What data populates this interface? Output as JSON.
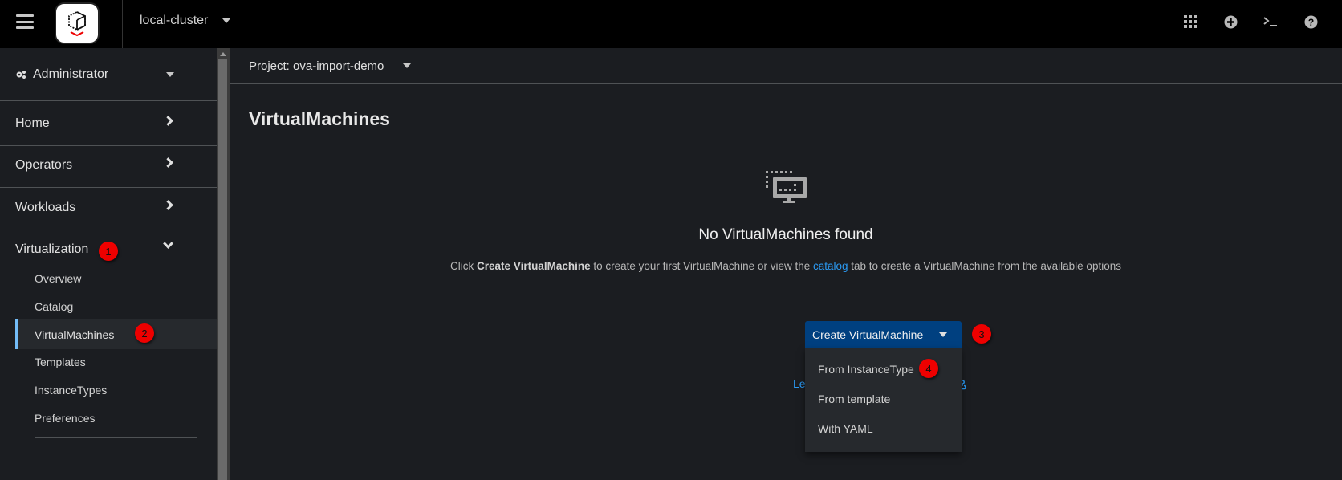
{
  "masthead": {
    "cluster": "local-cluster",
    "tools": [
      "app-launcher-icon",
      "quick-create-icon",
      "terminal-icon",
      "help-icon"
    ]
  },
  "sidebar": {
    "perspective": "Administrator",
    "sections": [
      {
        "label": "Home",
        "expanded": false
      },
      {
        "label": "Operators",
        "expanded": false
      },
      {
        "label": "Workloads",
        "expanded": false
      },
      {
        "label": "Virtualization",
        "expanded": true,
        "badge": "1"
      }
    ],
    "virtualization_items": [
      {
        "label": "Overview"
      },
      {
        "label": "Catalog"
      },
      {
        "label": "VirtualMachines",
        "active": true,
        "badge": "2"
      },
      {
        "label": "Templates"
      },
      {
        "label": "InstanceTypes"
      },
      {
        "label": "Preferences"
      }
    ]
  },
  "main": {
    "project": "Project: ova-import-demo",
    "title": "VirtualMachines",
    "empty_state": {
      "title": "No VirtualMachines found",
      "body_prefix": "Click ",
      "body_bold": "Create VirtualMachine",
      "body_middle": " to create your first VirtualMachine or view the ",
      "body_link": "catalog",
      "body_suffix": " tab to create a VirtualMachine from the available options"
    },
    "create_button": {
      "label": "Create VirtualMachine",
      "badge": "3"
    },
    "learn_link": "Le",
    "create_menu": [
      {
        "label": "From InstanceType",
        "badge": "4"
      },
      {
        "label": "From template"
      },
      {
        "label": "With YAML"
      }
    ]
  },
  "colors": {
    "accent": "#73bcf7",
    "primary_button": "#004080",
    "link": "#2b9af3",
    "badge": "#ee0000"
  }
}
